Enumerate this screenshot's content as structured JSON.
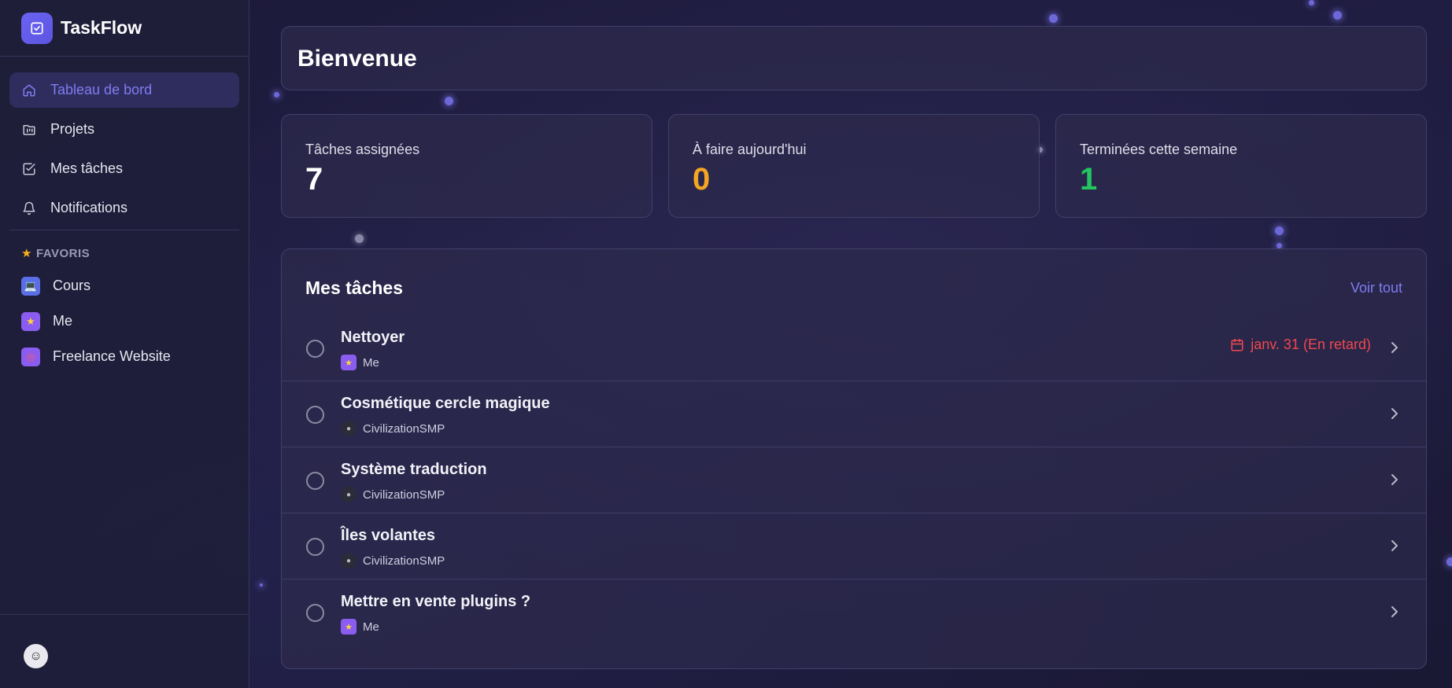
{
  "app": {
    "name": "TaskFlow"
  },
  "nav": {
    "items": [
      {
        "label": "Tableau de bord",
        "icon": "home-icon",
        "active": true
      },
      {
        "label": "Projets",
        "icon": "kanban-icon"
      },
      {
        "label": "Mes tâches",
        "icon": "checkbox-icon"
      },
      {
        "label": "Notifications",
        "icon": "bell-icon"
      }
    ]
  },
  "favorites": {
    "title": "FAVORIS",
    "items": [
      {
        "label": "Cours",
        "icon": "laptop-emoji",
        "color": "#5a6ee8"
      },
      {
        "label": "Me",
        "icon": "star-emoji",
        "color": "#8a5cf0"
      },
      {
        "label": "Freelance Website",
        "icon": "target-emoji",
        "color": "#8a5cf0"
      }
    ]
  },
  "welcome": {
    "title": "Bienvenue"
  },
  "stats": [
    {
      "label": "Tâches assignées",
      "value": "7",
      "color": "#ffffff"
    },
    {
      "label": "À faire aujourd'hui",
      "value": "0",
      "color": "#f5a524"
    },
    {
      "label": "Terminées cette semaine",
      "value": "1",
      "color": "#22c55e"
    }
  ],
  "tasks": {
    "title": "Mes tâches",
    "see_all": "Voir tout",
    "rows": [
      {
        "title": "Nettoyer",
        "project": "Me",
        "due": "janv. 31 (En retard)"
      },
      {
        "title": "Cosmétique cercle magique",
        "project": "CivilizationSMP",
        "due": ""
      },
      {
        "title": "Système traduction",
        "project": "CivilizationSMP",
        "due": ""
      },
      {
        "title": "Îles volantes",
        "project": "CivilizationSMP",
        "due": ""
      },
      {
        "title": "Mettre en vente plugins ?",
        "project": "Me",
        "due": ""
      }
    ]
  },
  "colors": {
    "accent": "#7f7cf0",
    "overdue": "#f0484d"
  }
}
